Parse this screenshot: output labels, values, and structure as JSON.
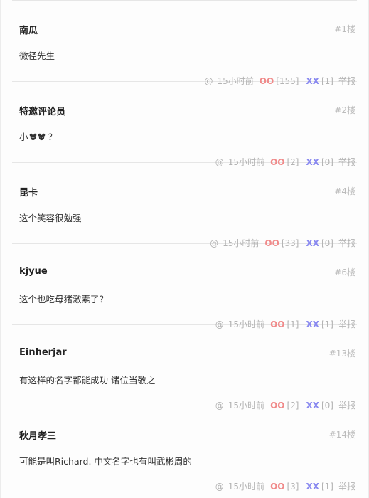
{
  "comments": [
    {
      "author": "南瓜",
      "floor": "#1楼",
      "content": "微径先生",
      "at": "@",
      "time": "15小时前",
      "oo": "OO",
      "oo_count": "[155]",
      "xx": "XX",
      "xx_count": "[1]",
      "report": "举报"
    },
    {
      "author": "特邀评论员",
      "floor": "#2楼",
      "content_prefix": "小",
      "content_suffix": "？",
      "emojis": [
        "mouse-face-icon",
        "mouse-face-icon"
      ],
      "at": "@",
      "time": "15小时前",
      "oo": "OO",
      "oo_count": "[2]",
      "xx": "XX",
      "xx_count": "[0]",
      "report": "举报"
    },
    {
      "author": "昆卡",
      "floor": "#4楼",
      "content": "这个笑容很勉强",
      "at": "@",
      "time": "15小时前",
      "oo": "OO",
      "oo_count": "[33]",
      "xx": "XX",
      "xx_count": "[0]",
      "report": "举报"
    },
    {
      "author": "kjyue",
      "floor": "#6楼",
      "content": "这个也吃母猪激素了？",
      "at": "@",
      "time": "15小时前",
      "oo": "OO",
      "oo_count": "[1]",
      "xx": "XX",
      "xx_count": "[1]",
      "report": "举报"
    },
    {
      "author": "Einherjar",
      "floor": "#13楼",
      "content": "有这样的名字都能成功 诸位当敬之",
      "at": "@",
      "time": "15小时前",
      "oo": "OO",
      "oo_count": "[2]",
      "xx": "XX",
      "xx_count": "[0]",
      "report": "举报"
    },
    {
      "author": "秋月孝三",
      "floor": "#14楼",
      "content": "可能是叫Richard. 中文名字也有叫武彬周的",
      "at": "@",
      "time": "15小时前",
      "oo": "OO",
      "oo_count": "[3]",
      "xx": "XX",
      "xx_count": "[1]",
      "report": "举报"
    }
  ],
  "colors": {
    "oo": "#f08a8a",
    "xx": "#8a8af0",
    "meta": "#b3b3b3",
    "author": "#222222"
  }
}
